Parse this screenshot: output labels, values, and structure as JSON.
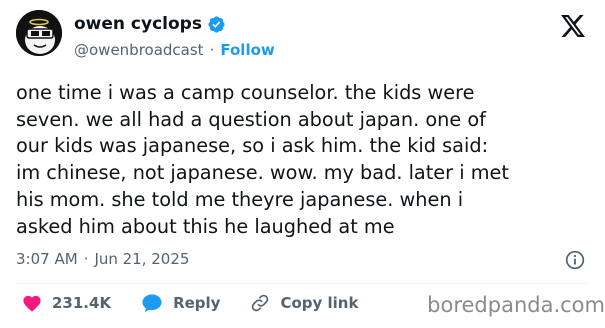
{
  "author": {
    "display_name": "owen cyclops",
    "handle": "@owenbroadcast",
    "separator": "·",
    "follow_label": "Follow"
  },
  "tweet": {
    "text": "one time i was a camp counselor. the kids were\nseven. we all had a question about japan. one of\nour kids was japanese, so i ask him. the kid said:\nim chinese, not japanese. wow. my bad. later i met\nhis mom. she told me theyre japanese. when i\nasked him about this he laughed at me",
    "time": "3:07 AM",
    "separator": "·",
    "date": "Jun 21, 2025"
  },
  "actions": {
    "like_count": "231.4K",
    "reply_label": "Reply",
    "copy_label": "Copy link"
  },
  "watermark": "boredpanda.com",
  "colors": {
    "accent": "#1d9bf0",
    "like": "#f91880",
    "text": "#0f1419",
    "muted": "#536471"
  },
  "icons": [
    "avatar",
    "verified-badge-icon",
    "x-logo-icon",
    "info-icon",
    "heart-icon",
    "reply-bubble-icon",
    "link-icon"
  ]
}
